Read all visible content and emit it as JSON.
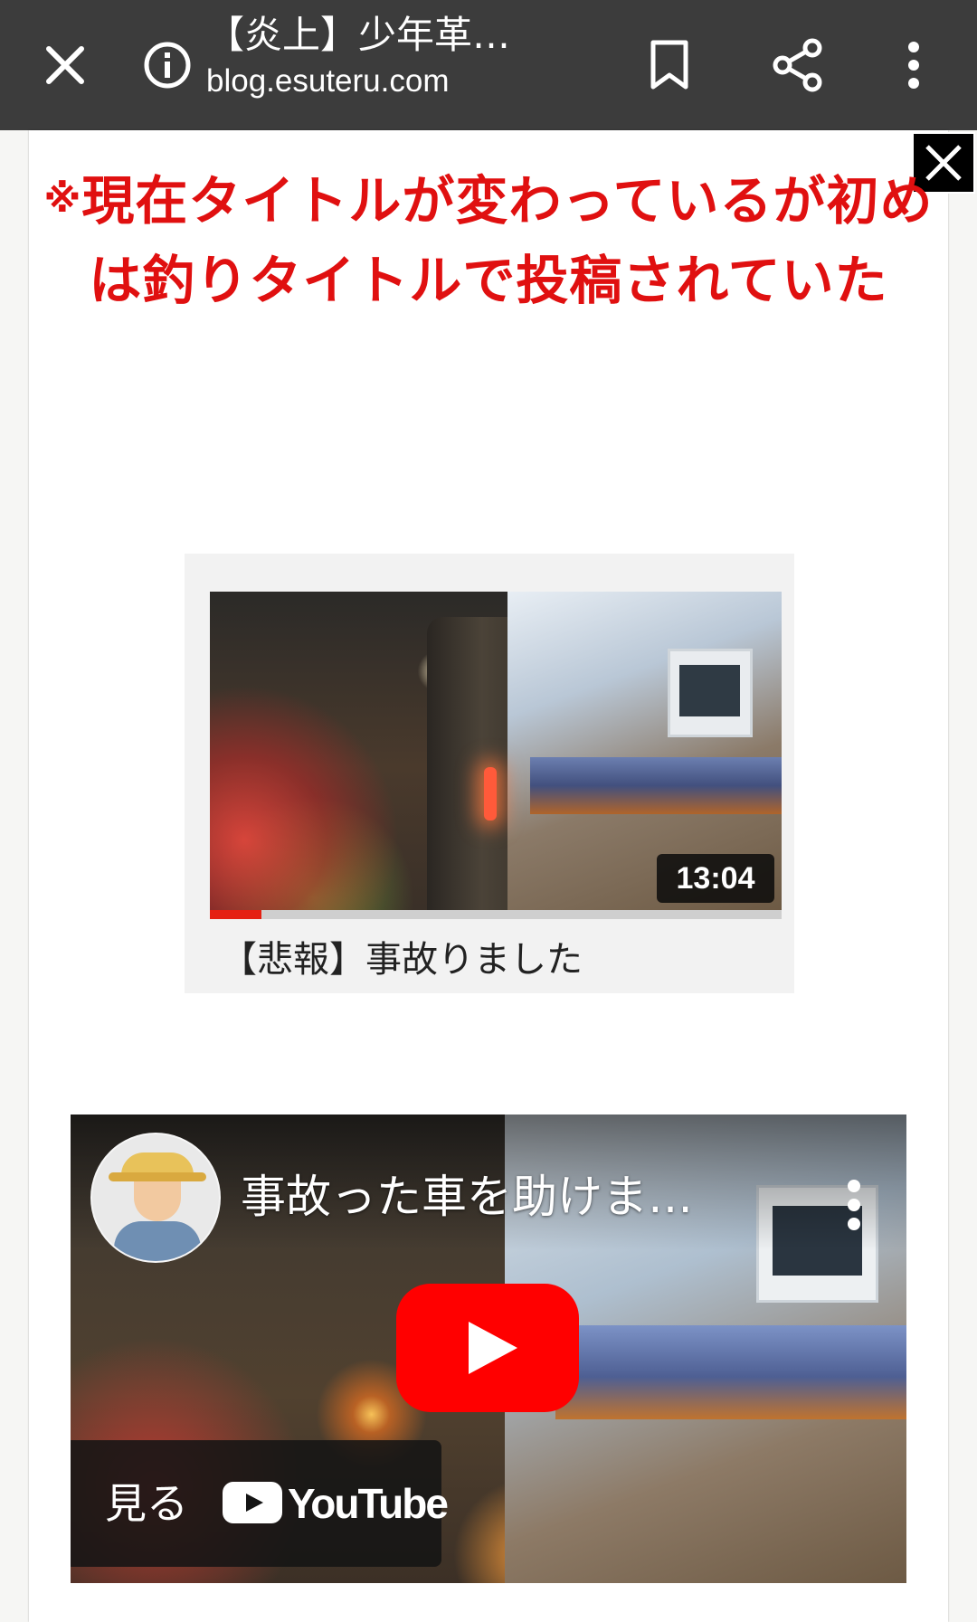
{
  "browser_bar": {
    "title": "【炎上】少年革…",
    "url": "blog.esuteru.com",
    "icons": [
      "close-icon",
      "info-icon",
      "bookmark-icon",
      "share-icon",
      "more-vert-icon"
    ]
  },
  "article": {
    "notice_mark": "※",
    "notice": "現在タイトルが変わっているが初めは釣りタイトルで投稿されていた"
  },
  "video_card": {
    "duration": "13:04",
    "title": "【悲報】事故りました",
    "watch_progress": 0.09
  },
  "youtube_embed": {
    "title": "事故った車を助けま…",
    "watch_label": "見る",
    "brand": "YouTube"
  },
  "colors": {
    "topbar": "#3c3c3c",
    "notice_red": "#e01010",
    "youtube_red": "#ff0000"
  }
}
